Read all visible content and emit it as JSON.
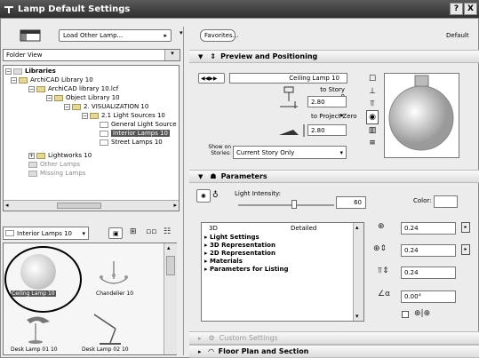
{
  "window": {
    "title": "Lamp Default Settings",
    "help_label": "?",
    "close_label": "X"
  },
  "left": {
    "load_button": "Load Other Lamp...",
    "folder_view": "Folder View",
    "tree": [
      "Libraries",
      "ArchiCAD Library 10",
      "ArchiCAD library 10.lcf",
      "Object Library 10",
      "2. VISUALIZATION 10",
      "2.1 Light Sources 10",
      "General Light Source",
      "Interior Lamps 10",
      "Street Lamps 10",
      "Lightworks 10",
      "Other Lamps",
      "Missing Lamps"
    ],
    "folder_select": "Interior Lamps 10",
    "thumbs": [
      "Ceiling Lamp 10",
      "Chandelier 10",
      "Desk Lamp 01 10",
      "Desk Lamp 02 10"
    ]
  },
  "top": {
    "favorites": "Favorites...",
    "default_label": "Default"
  },
  "preview": {
    "header": "Preview and Positioning",
    "lamp_name": "Ceiling Lamp 10",
    "to_story_label": "to Story 0",
    "story_value": "2.80",
    "to_zero_label": "to Project Zero",
    "zero_value": "2.80",
    "show_on_label": "Show on Stories:",
    "show_on_value": "Current Story Only"
  },
  "params": {
    "header": "Parameters",
    "intensity_label": "Light Intensity:",
    "intensity_value": "60",
    "color_label": "Color:",
    "col_3d": "3D",
    "col_detailed": "Detailed",
    "list": [
      "Light Settings",
      "3D Representation",
      "2D Representation",
      "Materials",
      "Parameters for Listing"
    ],
    "dims": [
      "0.24",
      "0.24",
      "0.24",
      "0.00°"
    ]
  },
  "collapsed": {
    "custom": "Custom Settings",
    "floor_plan": "Floor Plan and Section"
  }
}
